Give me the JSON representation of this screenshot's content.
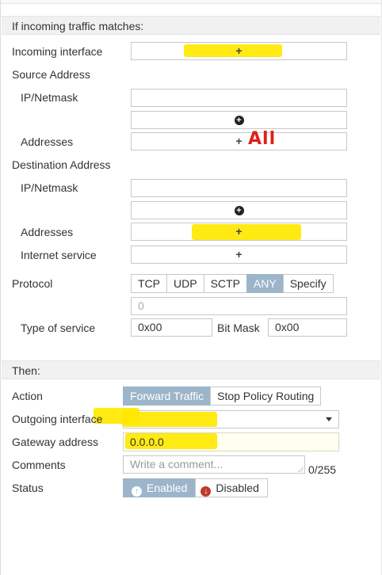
{
  "match_section": {
    "heading": "If incoming traffic matches:"
  },
  "incoming_interface": {
    "label": "Incoming interface",
    "add_glyph": "+"
  },
  "source_address": {
    "heading": "Source Address",
    "ip_netmask_label": "IP/Netmask",
    "ip_add_icon": "plus-circle-icon",
    "addresses_label": "Addresses",
    "addresses_add_glyph": "+",
    "annotation": "All"
  },
  "destination_address": {
    "heading": "Destination Address",
    "ip_netmask_label": "IP/Netmask",
    "ip_add_icon": "plus-circle-icon",
    "addresses_label": "Addresses",
    "addresses_add_glyph": "+",
    "internet_service_label": "Internet service",
    "internet_service_add_glyph": "+"
  },
  "protocol": {
    "label": "Protocol",
    "options": [
      "TCP",
      "UDP",
      "SCTP",
      "ANY",
      "Specify"
    ],
    "selected": "ANY",
    "number_value": "0"
  },
  "type_of_service": {
    "label": "Type of service",
    "value": "0x00",
    "bitmask_label": "Bit Mask",
    "bitmask_value": "0x00"
  },
  "then_section": {
    "heading": "Then:"
  },
  "action": {
    "label": "Action",
    "options": [
      "Forward Traffic",
      "Stop Policy Routing"
    ],
    "selected": "Forward Traffic"
  },
  "outgoing_interface": {
    "label": "Outgoing interface",
    "value": ""
  },
  "gateway": {
    "label": "Gateway address",
    "value": "0.0.0.0"
  },
  "comments": {
    "label": "Comments",
    "placeholder": "Write a comment...",
    "counter": "0/255"
  },
  "status": {
    "label": "Status",
    "enabled_label": "Enabled",
    "disabled_label": "Disabled",
    "selected": "Enabled"
  },
  "colors": {
    "accent": "#9cb5cb",
    "highlight": "#ffe800",
    "annotation": "#e0201a",
    "disabled_icon": "#c0392b"
  }
}
